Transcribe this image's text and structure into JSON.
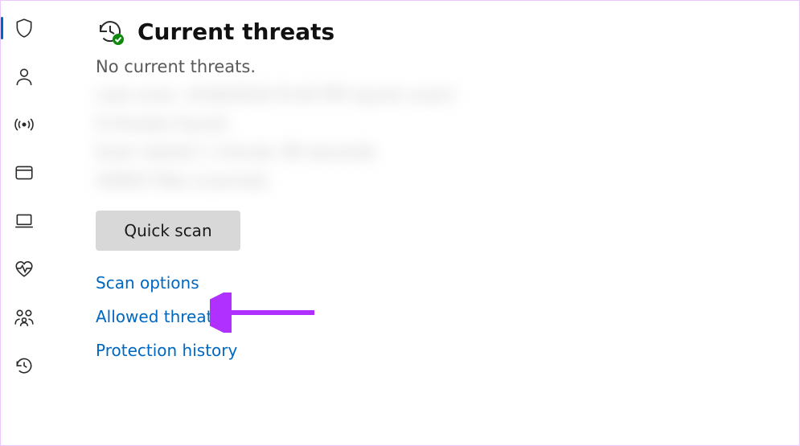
{
  "sidebar": {
    "items": [
      {
        "name": "virus-threat",
        "icon": "shield"
      },
      {
        "name": "account-protection",
        "icon": "person"
      },
      {
        "name": "firewall-network",
        "icon": "antenna"
      },
      {
        "name": "app-browser",
        "icon": "window"
      },
      {
        "name": "device-security",
        "icon": "laptop"
      },
      {
        "name": "device-performance",
        "icon": "heart"
      },
      {
        "name": "family-options",
        "icon": "family"
      },
      {
        "name": "protection-history",
        "icon": "history"
      }
    ]
  },
  "section": {
    "title": "Current threats",
    "status": "No current threats.",
    "blurred": {
      "l1": "Last scan: 4/18/2024 8:44 PM (quick scan)",
      "l2": "0 threats found.",
      "l3": "Scan lasted 1 minute 38 seconds",
      "l4": "42843 files scanned."
    },
    "quick_scan_label": "Quick scan",
    "links": {
      "scan_options": "Scan options",
      "allowed_threats": "Allowed threats",
      "protection_history": "Protection history"
    }
  },
  "annotation": {
    "arrow_color": "#b030ff"
  }
}
